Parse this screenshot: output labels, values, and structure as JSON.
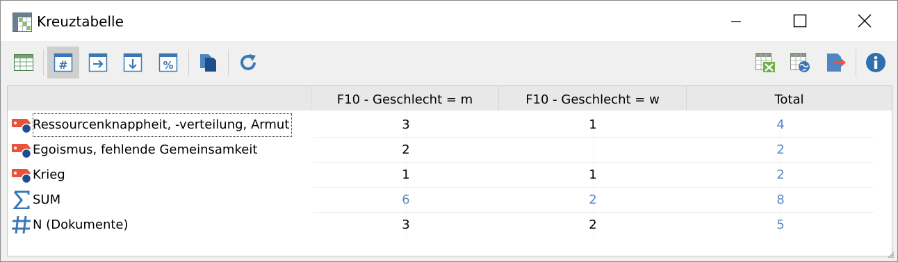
{
  "window": {
    "title": "Kreuztabelle"
  },
  "colors": {
    "link_blue": "#5a8ac6",
    "tag_red": "#e8533c",
    "tag_dot": "#1f4e8c"
  },
  "toolbar": {
    "buttons": [
      "table-icon",
      "hash-icon",
      "arrow-right-icon",
      "arrow-down-icon",
      "percent-icon",
      "copy-icon",
      "refresh-icon",
      "excel-export-icon",
      "web-export-icon",
      "export-icon",
      "info-icon"
    ]
  },
  "table": {
    "headers": [
      "F10 - Geschlecht = m",
      "F10 - Geschlecht = w",
      "Total"
    ],
    "rows": [
      {
        "label": "Ressourcenknappheit, -verteilung, Armut",
        "icon": "code-tag-icon",
        "m": "3",
        "w": "1",
        "total": "4"
      },
      {
        "label": "Egoismus, fehlende Gemeinsamkeit",
        "icon": "code-tag-icon",
        "m": "2",
        "w": "",
        "total": "2"
      },
      {
        "label": "Krieg",
        "icon": "code-tag-icon",
        "m": "1",
        "w": "1",
        "total": "2"
      },
      {
        "label": "SUM",
        "icon": "sigma-icon",
        "m": "6",
        "w": "2",
        "total": "8"
      },
      {
        "label": "N (Dokumente)",
        "icon": "hash-icon",
        "m": "3",
        "w": "2",
        "total": "5"
      }
    ]
  }
}
